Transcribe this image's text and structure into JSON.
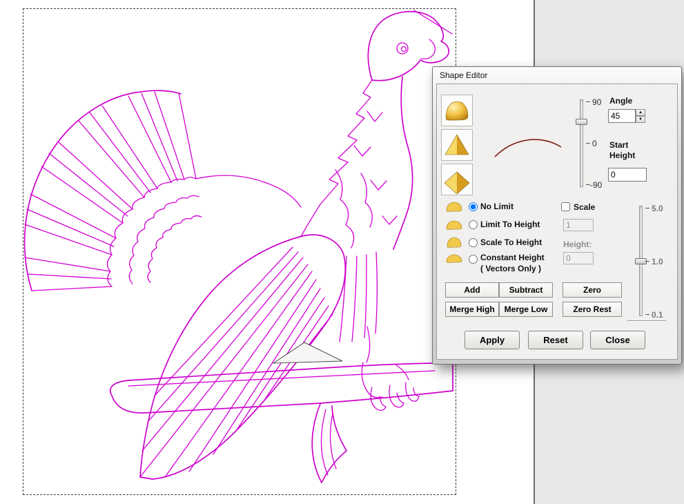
{
  "colors": {
    "vector_stroke": "#d400d4",
    "curve_stroke": "#7c1d12",
    "gold": "#f0c040"
  },
  "artwork": {
    "name": "eagle-vector-drawing"
  },
  "dialog": {
    "title": "Shape Editor",
    "angle_slider": {
      "top": "90",
      "middle": "0",
      "bottom": "-90"
    },
    "angle": {
      "label": "Angle",
      "value": "45"
    },
    "start_height": {
      "label": "Start Height",
      "value": "0"
    },
    "limit_options": [
      {
        "label": "No Limit",
        "selected": true
      },
      {
        "label": "Limit To Height",
        "selected": false
      },
      {
        "label": "Scale To Height",
        "selected": false
      },
      {
        "label": "Constant Height",
        "sublabel": "( Vectors Only )",
        "selected": false
      }
    ],
    "scale": {
      "checkbox_label": "Scale",
      "checked": false,
      "value": "1",
      "height_label": "Height:",
      "height_value": "0"
    },
    "scale_slider": {
      "top": "5.0",
      "middle": "1.0",
      "bottom": "0.1"
    },
    "combine_buttons": {
      "add": "Add",
      "subtract": "Subtract",
      "zero": "Zero",
      "merge_high": "Merge High",
      "merge_low": "Merge Low",
      "zero_rest": "Zero Rest"
    },
    "action_buttons": {
      "apply": "Apply",
      "reset": "Reset",
      "close": "Close"
    }
  }
}
